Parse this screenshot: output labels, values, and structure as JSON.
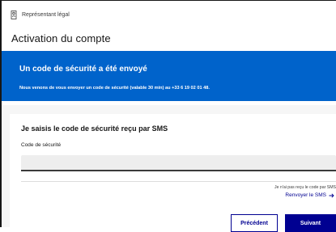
{
  "header": {
    "breadcrumb_label": "Représentant légal",
    "breadcrumb_icon": "person-badge-icon",
    "page_title": "Activation du compte"
  },
  "alert": {
    "title": "Un code de sécurité a été envoyé",
    "text": "Nous venons de vous envoyer un code de sécurité (valable 30 min) au +33 6 19 02 01 48.",
    "color": "#0063cb"
  },
  "form": {
    "title": "Je saisis le code de sécurité reçu par SMS",
    "code_label": "Code de sécurité",
    "code_value": "",
    "not_received_text": "Je n'ai pas reçu le code par SMS",
    "resend_label": "Renvoyer le SMS",
    "resend_icon": "arrow-right-icon"
  },
  "actions": {
    "previous_label": "Précédent",
    "next_label": "Suivant",
    "primary_color": "#000091"
  }
}
